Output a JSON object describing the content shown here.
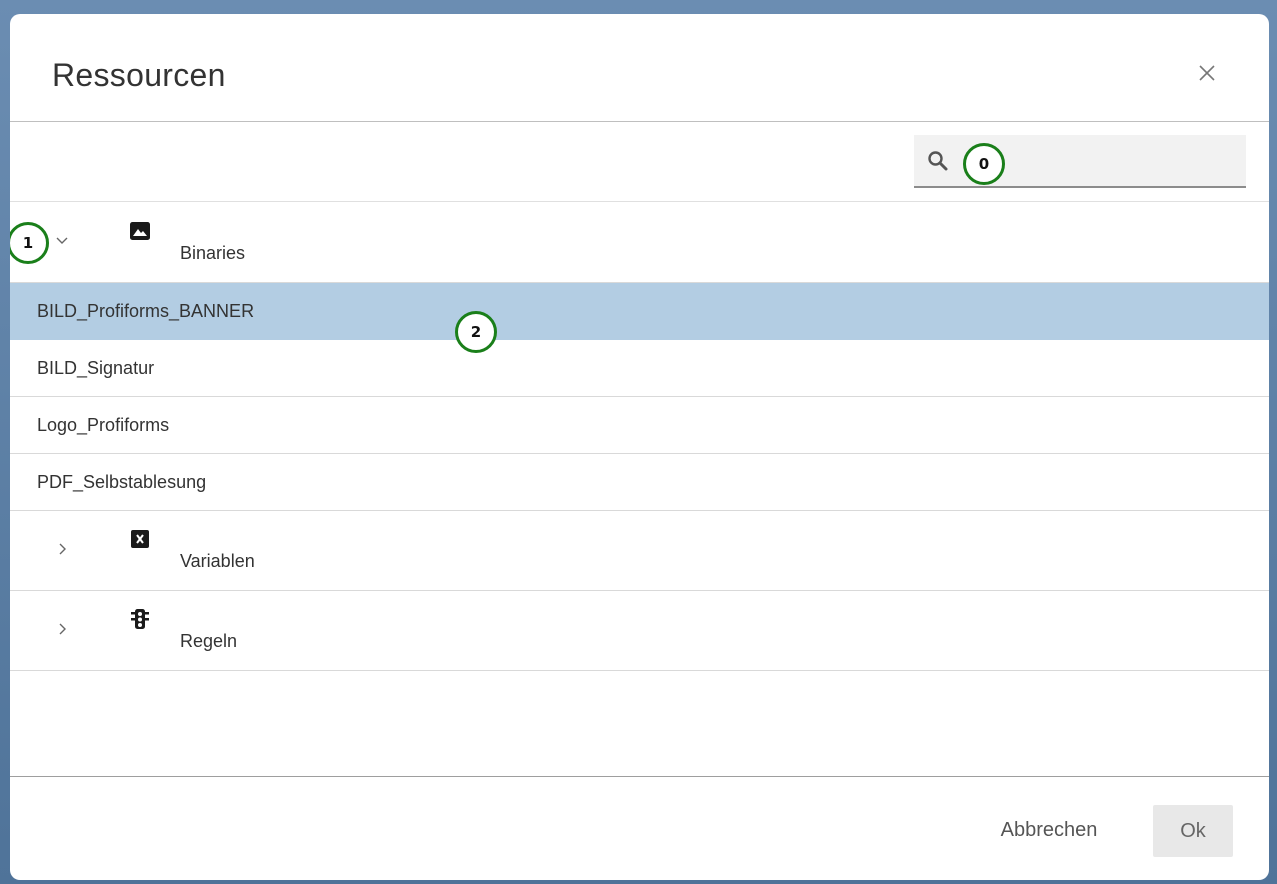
{
  "dialog": {
    "title": "Ressourcen",
    "close_icon": "close-icon"
  },
  "search": {
    "icon": "search-icon",
    "value": "",
    "placeholder": ""
  },
  "markers": [
    "0",
    "1",
    "2"
  ],
  "tree": {
    "groups": [
      {
        "label": "Binaries",
        "icon": "image-icon",
        "expanded": true,
        "items": [
          "BILD_Profiforms_BANNER",
          "BILD_Signatur",
          "Logo_Profiforms",
          "PDF_Selbstablesung"
        ],
        "selected_index": 0
      },
      {
        "label": "Variablen",
        "icon": "variable-icon",
        "expanded": false
      },
      {
        "label": "Regeln",
        "icon": "traffic-light-icon",
        "expanded": false
      }
    ]
  },
  "footer": {
    "cancel_label": "Abbrechen",
    "ok_label": "Ok"
  },
  "colors": {
    "selected_row": "#b3cde3",
    "marker_ring": "#1a7f1a",
    "backdrop": "#5a7fa6"
  }
}
